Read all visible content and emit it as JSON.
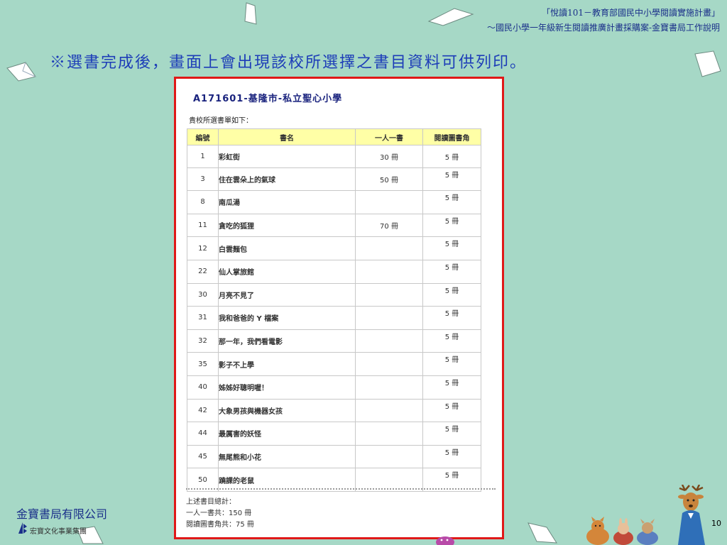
{
  "header": {
    "line1": "「悅讀101－教育部國民中小學閱讀實施計畫」",
    "line2": "～國民小學一年級新生閱讀推廣計畫採購案-金寶書局工作說明"
  },
  "heading": "※選書完成後，畫面上會出現該校所選擇之書目資料可供列印。",
  "document": {
    "title": "A171601-基隆市-私立聖心小學",
    "subtitle": "貴校所選書單如下：",
    "columns": [
      "編號",
      "書名",
      "一人一書",
      "閱讀圖書角"
    ],
    "rows": [
      {
        "num": "1",
        "title": "彩虹街",
        "one": "30 冊",
        "corner": "5 冊"
      },
      {
        "num": "3",
        "title": "住在雲朵上的氣球",
        "one": "50 冊",
        "corner": "5 冊"
      },
      {
        "num": "8",
        "title": "南瓜湯",
        "one": "",
        "corner": "5 冊"
      },
      {
        "num": "11",
        "title": "貪吃的狐狸",
        "one": "70 冊",
        "corner": "5 冊"
      },
      {
        "num": "12",
        "title": "白雲麵包",
        "one": "",
        "corner": "5 冊"
      },
      {
        "num": "22",
        "title": "仙人掌旅館",
        "one": "",
        "corner": "5 冊"
      },
      {
        "num": "30",
        "title": "月亮不見了",
        "one": "",
        "corner": "5 冊"
      },
      {
        "num": "31",
        "title": "我和爸爸的 Y 檔案",
        "one": "",
        "corner": "5 冊"
      },
      {
        "num": "32",
        "title": "那一年，我們看電影",
        "one": "",
        "corner": "5 冊"
      },
      {
        "num": "35",
        "title": "影子不上學",
        "one": "",
        "corner": "5 冊"
      },
      {
        "num": "40",
        "title": "姊姊好聰明喔！",
        "one": "",
        "corner": "5 冊"
      },
      {
        "num": "42",
        "title": "大象男孩與機器女孩",
        "one": "",
        "corner": "5 冊"
      },
      {
        "num": "44",
        "title": "最厲害的妖怪",
        "one": "",
        "corner": "5 冊"
      },
      {
        "num": "45",
        "title": "無尾熊和小花",
        "one": "",
        "corner": "5 冊"
      },
      {
        "num": "50",
        "title": "蹺課的老鼠",
        "one": "",
        "corner": "5 冊"
      }
    ],
    "summary": {
      "label": "上述書目總計：",
      "one_total": "一人一書共：150 冊",
      "corner_total": "閱讀圖書角共：75 冊"
    }
  },
  "footer": {
    "company": "金寶書局有限公司",
    "group": "宏寶文化事業集團",
    "page_number": "10"
  },
  "colors": {
    "background": "#a6d8c6",
    "frame_border": "#e01818",
    "book_title": "#0b7a12",
    "table_header": "#ffffa6",
    "heading_text": "#1d3db8"
  }
}
